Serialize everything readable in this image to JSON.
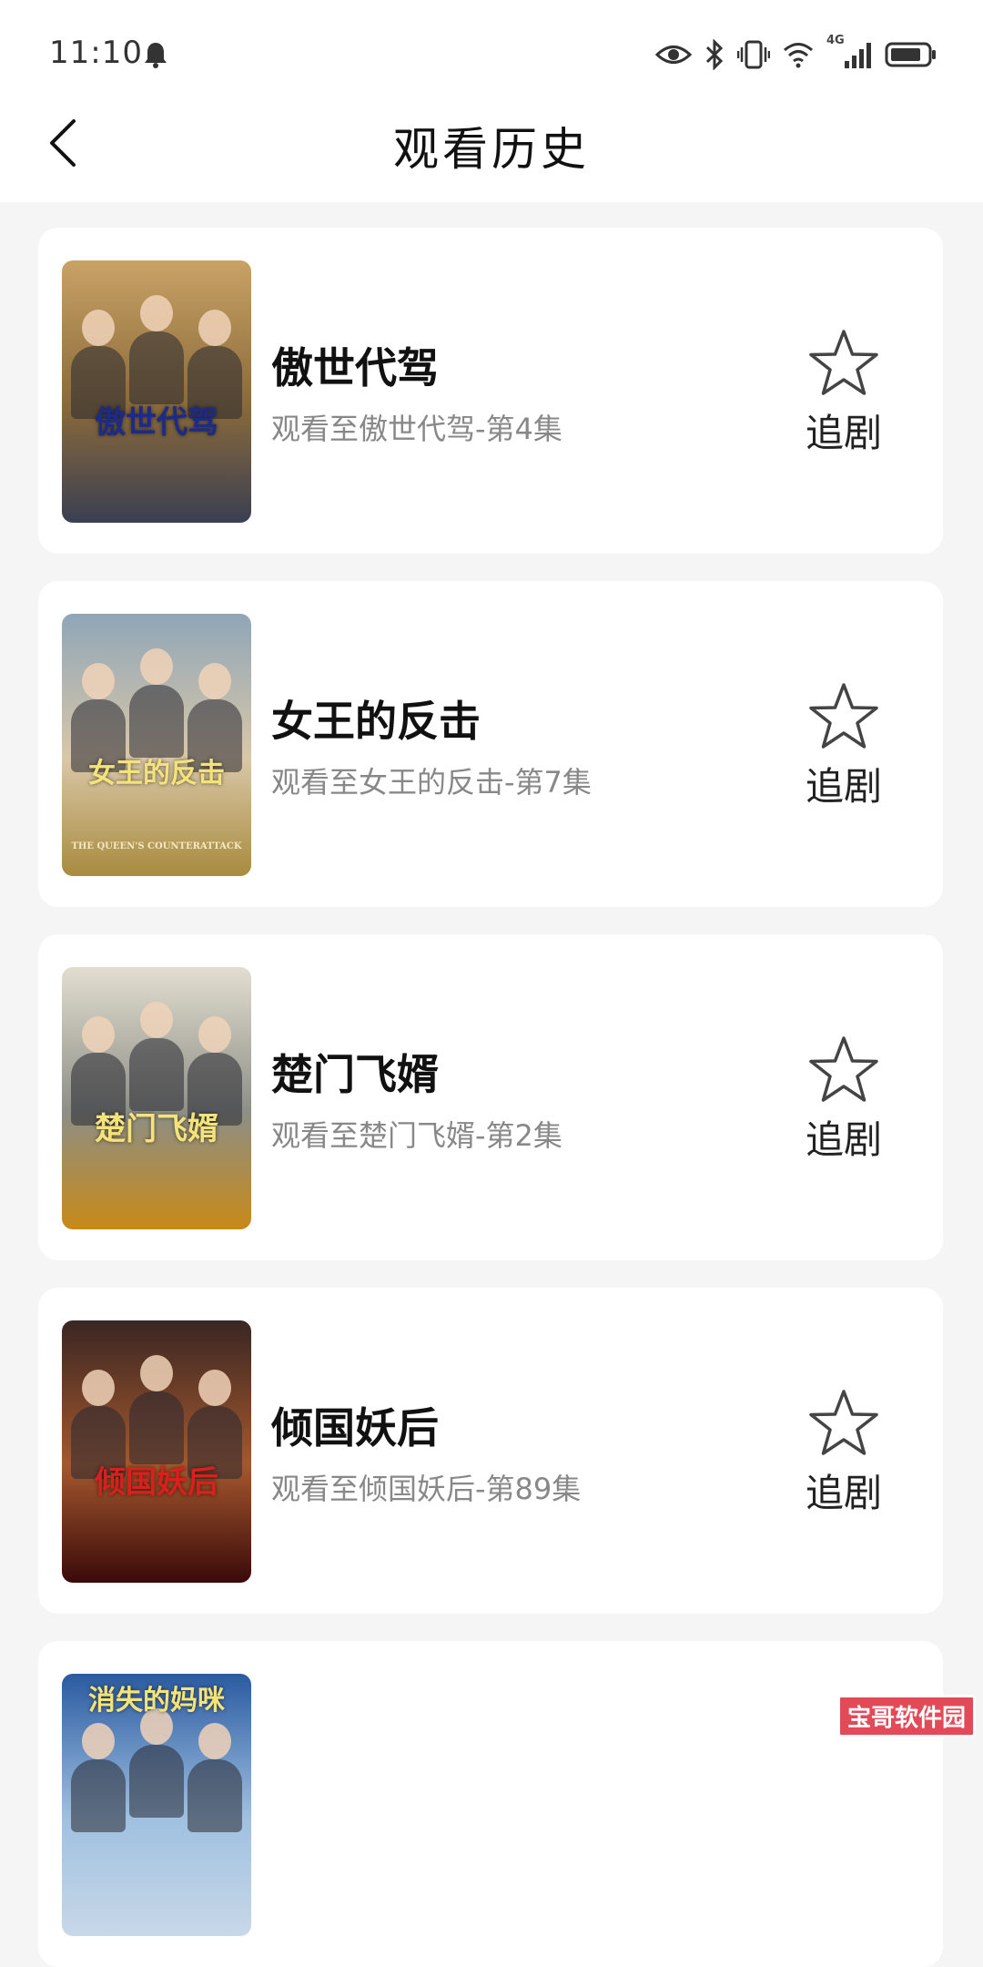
{
  "status_bar": {
    "time": "11:10",
    "network": "4G",
    "icons": [
      "bell-icon",
      "eye-icon",
      "bluetooth-icon",
      "vibrate-icon",
      "wifi-icon",
      "signal-icon",
      "battery-icon"
    ]
  },
  "header": {
    "back_icon": "chevron-left-icon",
    "title": "观看历史"
  },
  "history": [
    {
      "title": "傲世代驾",
      "progress": "观看至傲世代驾-第4集",
      "follow_label": "追剧",
      "poster_text": "傲世代驾",
      "poster_colors": [
        "#c9a266",
        "#8a6a3a",
        "#3a3f52"
      ]
    },
    {
      "title": "女王的反击",
      "progress": "观看至女王的反击-第7集",
      "follow_label": "追剧",
      "poster_text": "女王的反击",
      "poster_sub": "THE QUEEN'S COUNTERATTACK",
      "poster_colors": [
        "#8fa6b8",
        "#d9c7a8",
        "#a88b3e"
      ]
    },
    {
      "title": "楚门飞婿",
      "progress": "观看至楚门飞婿-第2集",
      "follow_label": "追剧",
      "poster_text": "楚门飞婿",
      "poster_colors": [
        "#e2ddd0",
        "#8d8f86",
        "#c88a18"
      ]
    },
    {
      "title": "倾国妖后",
      "progress": "观看至倾国妖后-第89集",
      "follow_label": "追剧",
      "poster_text": "倾国妖后",
      "poster_colors": [
        "#3a2622",
        "#a4582e",
        "#3a0a0a"
      ]
    },
    {
      "title": "",
      "progress": "",
      "follow_label": "",
      "poster_text": "消失的妈咪",
      "poster_colors": [
        "#2a5aa0",
        "#9fc0e0",
        "#c8d8e8"
      ]
    }
  ],
  "watermark": "宝哥软件园",
  "colors": {
    "background": "#f5f5f5",
    "card": "#ffffff",
    "subtitle": "#888888",
    "watermark": "#e34a58"
  }
}
